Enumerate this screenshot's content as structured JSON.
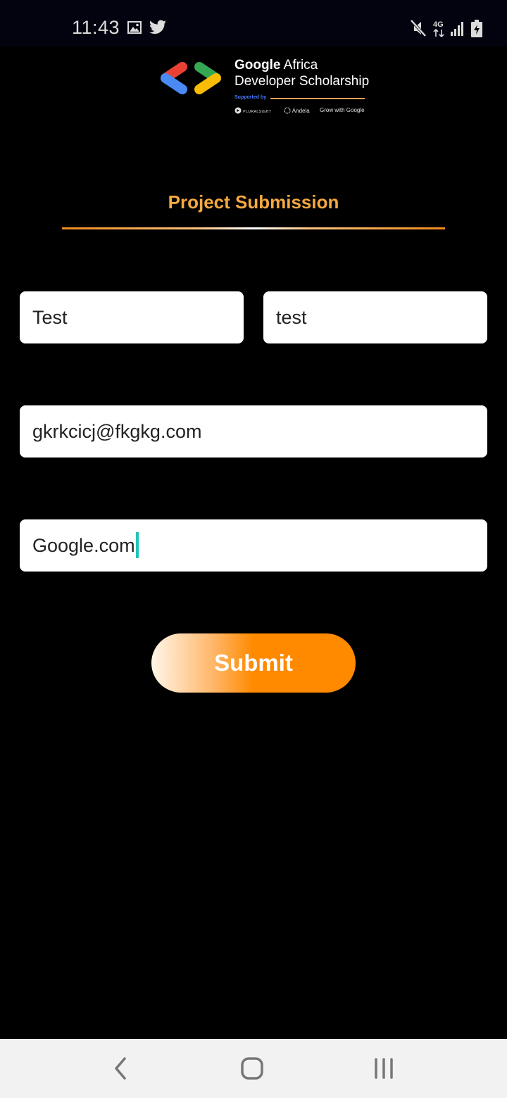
{
  "status_bar": {
    "time": "11:43",
    "left_icons": [
      "image-icon",
      "twitter-icon"
    ],
    "right_icons": [
      "mute-icon",
      "network-4g-icon",
      "signal-icon",
      "battery-charging-icon"
    ],
    "network_label": "4G"
  },
  "logo": {
    "line1_bold": "Google",
    "line1_rest": " Africa",
    "line2": "Developer Scholarship",
    "supported_by": "Supported by",
    "sponsors": [
      "PLURALSIGHT",
      "Andela",
      "Grow with Google"
    ]
  },
  "page": {
    "title": "Project Submission"
  },
  "form": {
    "first_name": "Test",
    "last_name": "test",
    "email": "gkrkcicj@fkgkg.com",
    "project_link": "Google.com",
    "submit_label": "Submit"
  },
  "nav": {
    "icons": [
      "back-icon",
      "home-icon",
      "recent-apps-icon"
    ]
  },
  "colors": {
    "background": "#000000",
    "title": "#f5a940",
    "accent": "#ff8a00",
    "caret": "#1fc3b8"
  }
}
